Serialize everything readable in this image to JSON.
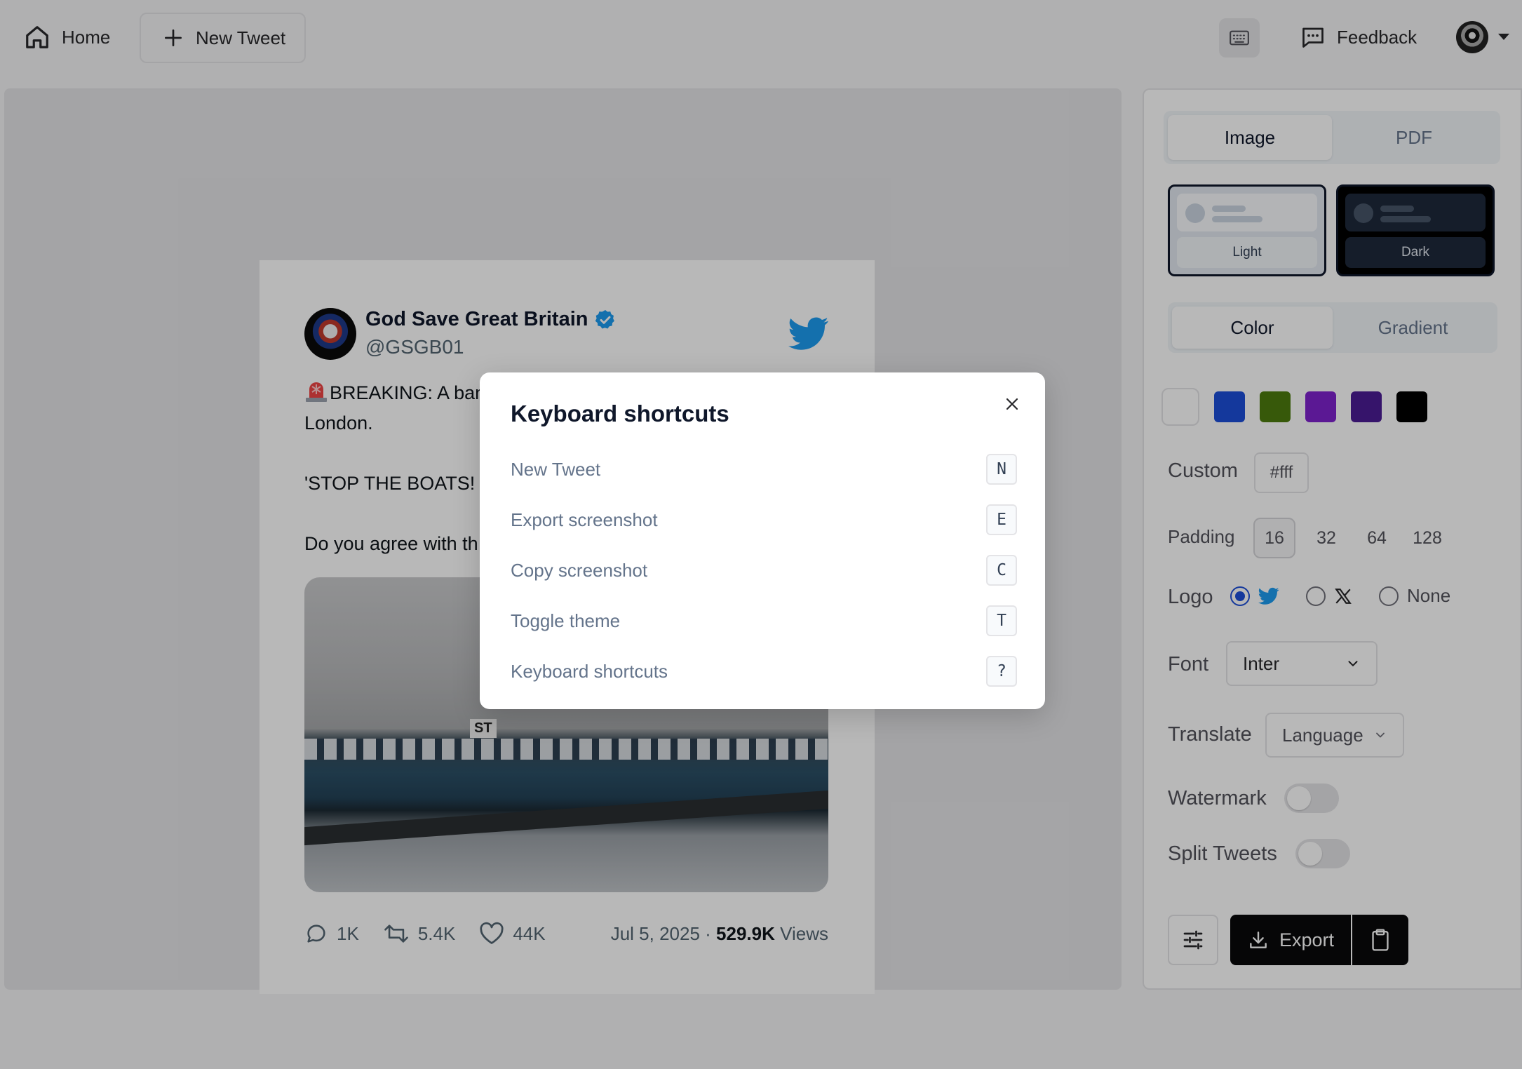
{
  "topbar": {
    "home_label": "Home",
    "new_tweet_label": "New Tweet",
    "feedback_label": "Feedback"
  },
  "tweet": {
    "name": "God Save Great Britain",
    "handle": "@GSGB01",
    "text_line1": "BREAKING: A banner has been draped over tower bridge, London.",
    "text_line2": "'STOP THE BOATS!",
    "text_line3": "Do you agree with th",
    "stats": {
      "replies": "1K",
      "retweets": "5.4K",
      "likes": "44K",
      "date": "Jul 5, 2025 ·",
      "views_count": "529.9K",
      "views_label": "Views"
    },
    "image_banner_text": "ST"
  },
  "sidebar": {
    "format_tabs": [
      "Image",
      "PDF"
    ],
    "themes": [
      "Light",
      "Dark"
    ],
    "bg_tabs": [
      "Color",
      "Gradient"
    ],
    "swatch_colors": [
      "#ffffff",
      "#1d4ed8",
      "#4d7c0f",
      "#7e22ce",
      "#4c1d95",
      "#000000"
    ],
    "custom_label": "Custom",
    "custom_value": "#fff",
    "padding_label": "Padding",
    "padding_options": [
      "16",
      "32",
      "64",
      "128"
    ],
    "padding_selected": "16",
    "logo_label": "Logo",
    "logo_none_label": "None",
    "font_label": "Font",
    "font_value": "Inter",
    "translate_label": "Translate",
    "language_value": "Language",
    "watermark_label": "Watermark",
    "split_label": "Split Tweets",
    "export_label": "Export"
  },
  "modal": {
    "title": "Keyboard shortcuts",
    "shortcuts": [
      {
        "label": "New Tweet",
        "key": "N"
      },
      {
        "label": "Export screenshot",
        "key": "E"
      },
      {
        "label": "Copy screenshot",
        "key": "C"
      },
      {
        "label": "Toggle theme",
        "key": "T"
      },
      {
        "label": "Keyboard shortcuts",
        "key": "?"
      }
    ]
  },
  "colors": {
    "twitter_blue": "#1d9bf0",
    "verified_blue": "#1d9bf0",
    "radio_accent": "#1d4ed8"
  }
}
